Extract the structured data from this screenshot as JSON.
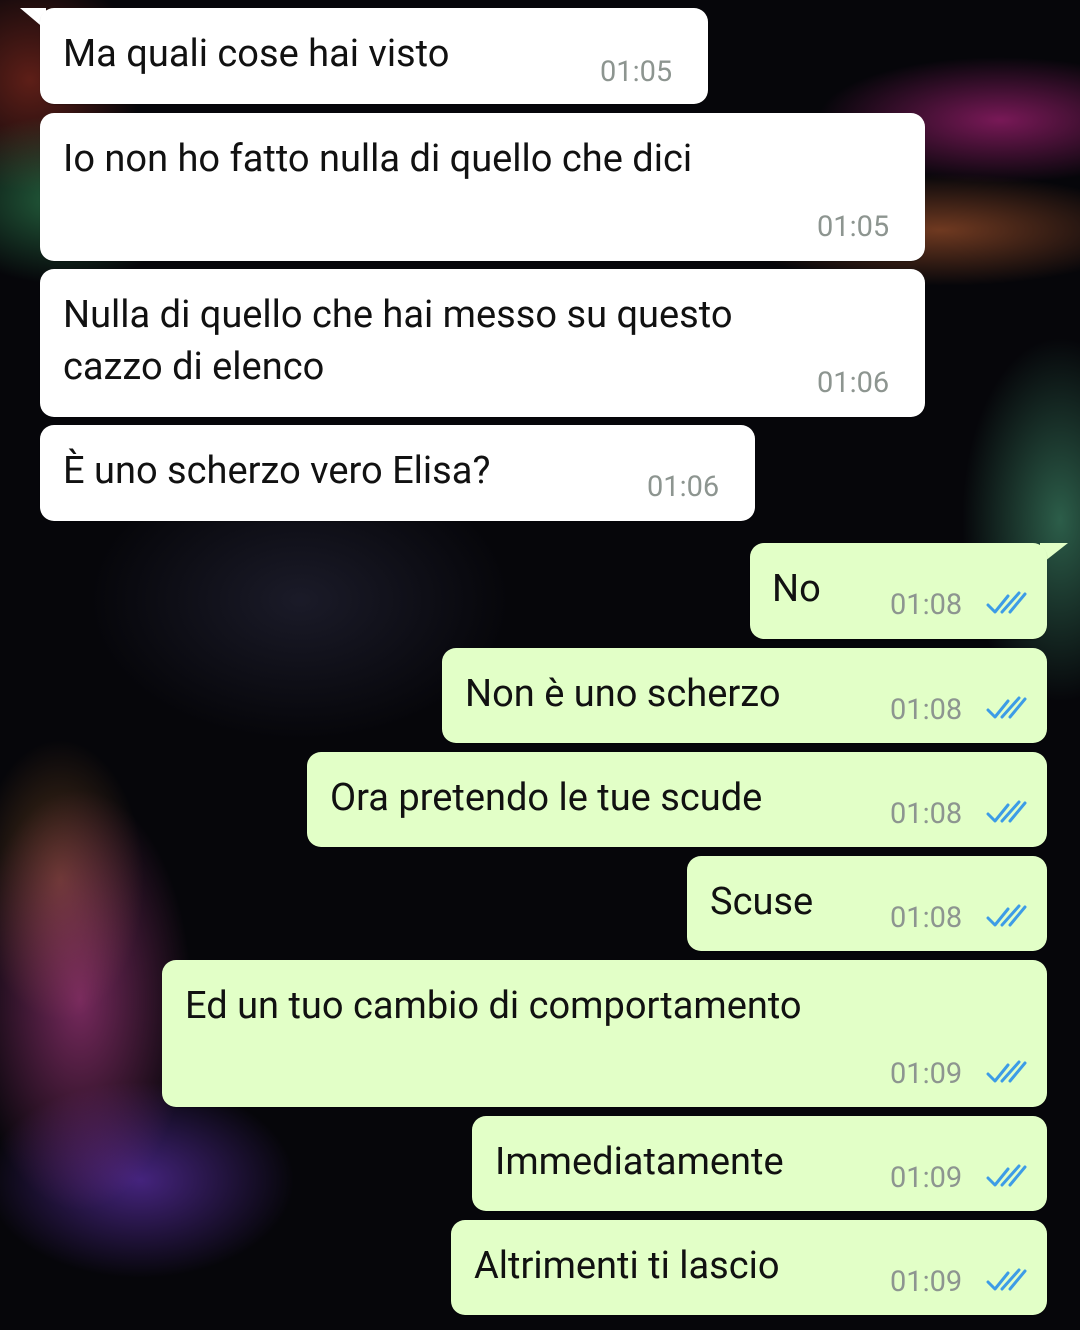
{
  "colors": {
    "incoming_bubble": "#ffffff",
    "outgoing_bubble": "#e2ffc7",
    "timestamp": "#8d9590",
    "read_ticks": "#3d9ce6"
  },
  "messages": [
    {
      "direction": "incoming",
      "text": "Ma quali cose hai visto",
      "time": "01:05"
    },
    {
      "direction": "incoming",
      "text": "Io non ho fatto nulla di quello che dici",
      "time": "01:05"
    },
    {
      "direction": "incoming",
      "text": "Nulla di quello che hai messo su questo\ncazzo di elenco",
      "time": "01:06"
    },
    {
      "direction": "incoming",
      "text": "È uno scherzo vero Elisa?",
      "time": "01:06"
    },
    {
      "direction": "outgoing",
      "text": "No",
      "time": "01:08",
      "status_icon": "double-check-read-icon"
    },
    {
      "direction": "outgoing",
      "text": "Non è uno scherzo",
      "time": "01:08",
      "status_icon": "double-check-read-icon"
    },
    {
      "direction": "outgoing",
      "text": "Ora pretendo le tue scude",
      "time": "01:08",
      "status_icon": "double-check-read-icon"
    },
    {
      "direction": "outgoing",
      "text": "Scuse",
      "time": "01:08",
      "status_icon": "double-check-read-icon"
    },
    {
      "direction": "outgoing",
      "text": "Ed un tuo cambio di comportamento",
      "time": "01:09",
      "status_icon": "double-check-read-icon"
    },
    {
      "direction": "outgoing",
      "text": "Immediatamente",
      "time": "01:09",
      "status_icon": "double-check-read-icon"
    },
    {
      "direction": "outgoing",
      "text": "Altrimenti ti lascio",
      "time": "01:09",
      "status_icon": "double-check-read-icon"
    }
  ]
}
